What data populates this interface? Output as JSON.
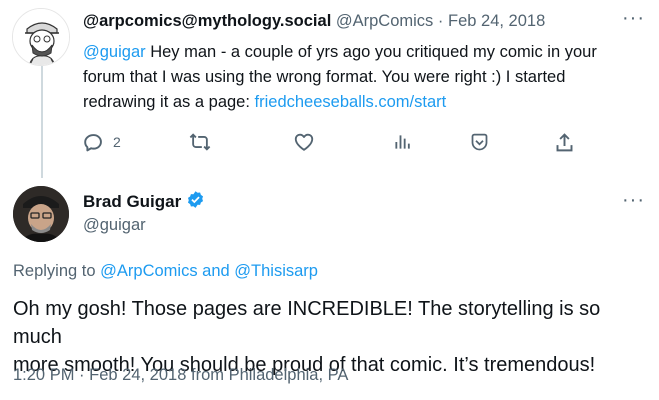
{
  "parent_tweet": {
    "display_name": "@arpcomics@mythology.social",
    "handle": "@ArpComics",
    "separator": "·",
    "date": "Feb 24, 2018",
    "mention": "@guigar",
    "text_line_1_rest": " Hey man - a couple of yrs ago you critiqued my comic in your",
    "text_line_2": "forum that I was using the wrong format. You were right :) I started",
    "text_line_3_prefix": "redrawing it as a page: ",
    "link": "friedcheeseballs.com/start",
    "actions": {
      "reply_icon": "reply-icon",
      "reply_count": "2",
      "retweet_icon": "retweet-icon",
      "like_icon": "heart-icon",
      "views_icon": "views-icon",
      "bookmark_icon": "bookmark-icon",
      "share_icon": "share-icon"
    }
  },
  "main_tweet": {
    "display_name": "Brad Guigar",
    "verified_icon": "verified-badge-icon",
    "handle": "@guigar",
    "replying_prefix": "Replying to ",
    "replying_user_1": "@ArpComics",
    "replying_and": " and ",
    "replying_user_2": "@Thisisarp",
    "text_line_1": "Oh my gosh! Those pages are INCREDIBLE! The storytelling is so much",
    "text_line_2": "more smooth! You should be proud of that comic. It’s tremendous!",
    "time": "1:20 PM",
    "separator": "·",
    "date": "Feb 24, 2018",
    "location": "from Philadelphia, PA"
  },
  "more_icon": "more-options-icon",
  "colors": {
    "link": "#1d9bf0",
    "muted": "#536471",
    "text": "#0f1419",
    "thread_line": "#cfd9de"
  }
}
